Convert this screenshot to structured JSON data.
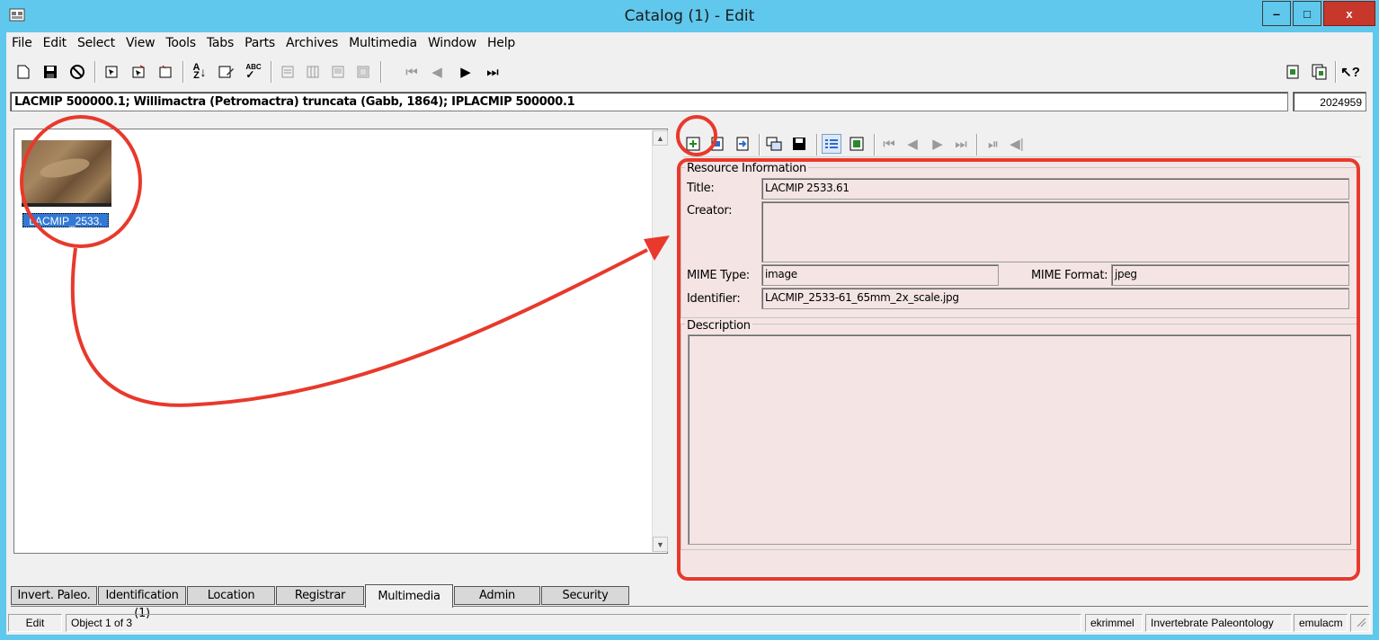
{
  "window": {
    "title": "Catalog (1) - Edit",
    "controls": {
      "minimize": "‒",
      "maximize": "□",
      "close": "x"
    }
  },
  "menu": [
    "File",
    "Edit",
    "Select",
    "View",
    "Tools",
    "Tabs",
    "Parts",
    "Archives",
    "Multimedia",
    "Window",
    "Help"
  ],
  "record": {
    "summary": "LACMIP 500000.1; Willimactra (Petromactra) truncata (Gabb, 1864); IPLACMIP 500000.1",
    "irn": "2024959"
  },
  "multimedia": {
    "thumbnail_label": "LACMIP_2533."
  },
  "resource": {
    "group_label": "Resource Information",
    "title_label": "Title:",
    "title_value": "LACMIP 2533.61",
    "creator_label": "Creator:",
    "creator_value": "",
    "mime_type_label": "MIME Type:",
    "mime_type_value": "image",
    "mime_format_label": "MIME Format:",
    "mime_format_value": "jpeg",
    "identifier_label": "Identifier:",
    "identifier_value": "LACMIP_2533-61_65mm_2x_scale.jpg"
  },
  "description": {
    "group_label": "Description",
    "value": ""
  },
  "tabs": [
    "Invert. Paleo.",
    "Identification (1)",
    "Location",
    "Registrar",
    "Multimedia",
    "Admin",
    "Security"
  ],
  "active_tab": "Multimedia",
  "status": {
    "mode": "Edit",
    "object": "Object 1 of 3",
    "user": "ekrimmel",
    "department": "Invertebrate Paleontology",
    "server": "emulacm"
  },
  "colors": {
    "titlebar": "#60c8ec",
    "annotation_red": "#e8392c",
    "field_pink": "#f5e4e4",
    "selection_blue": "#3378d4"
  }
}
